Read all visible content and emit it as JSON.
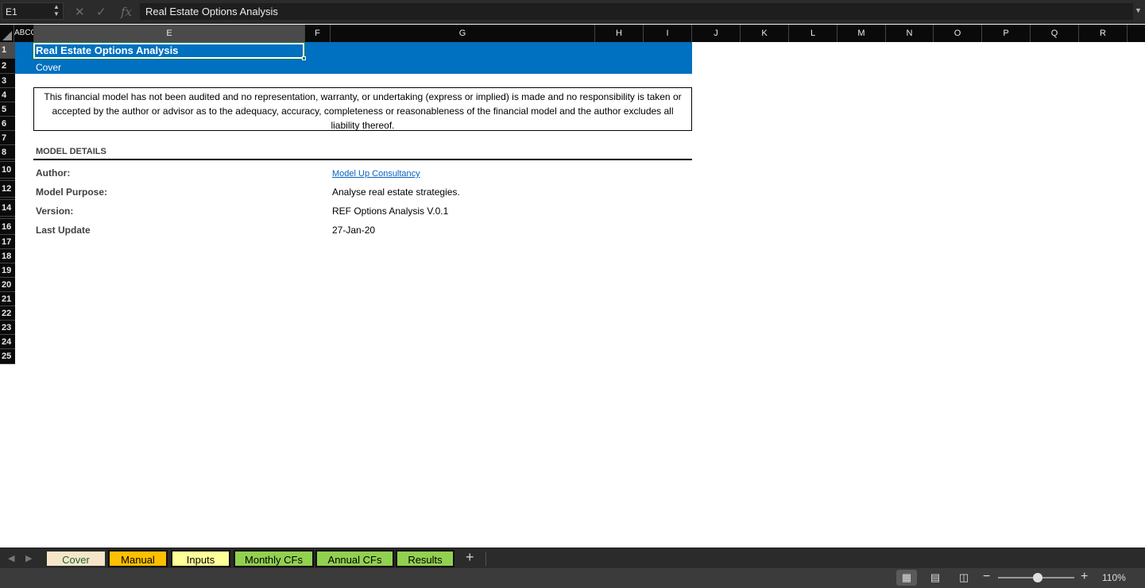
{
  "formula_bar": {
    "name_box": "E1",
    "formula": "Real Estate Options Analysis",
    "fx_label": "fx"
  },
  "columns": [
    "A",
    "B",
    "C",
    "C",
    "E",
    "F",
    "G",
    "H",
    "I",
    "J",
    "K",
    "L",
    "M",
    "N",
    "O",
    "P",
    "Q",
    "R"
  ],
  "columns_display": {
    "abcc": "ABCC",
    "e": "E",
    "f": "F",
    "g": "G",
    "h": "H",
    "i": "I",
    "j": "J",
    "k": "K",
    "l": "L",
    "m": "M",
    "n": "N",
    "o": "O",
    "p": "P",
    "q": "Q",
    "r": "R"
  },
  "rows": {
    "r1": "1",
    "r2": "2",
    "r3": "3",
    "r4": "4",
    "r5": "5",
    "r6": "6",
    "r7": "7",
    "r8": "8",
    "r10": "10",
    "r12": "12",
    "r14": "14",
    "r16": "16",
    "r17": "17",
    "r18": "18",
    "r19": "19",
    "r20": "20",
    "r21": "21",
    "r22": "22",
    "r23": "23",
    "r24": "24",
    "r25": "25"
  },
  "sheet": {
    "title": "Real Estate Options Analysis",
    "subtitle": "Cover",
    "disclaimer": "This financial model has not been audited and no representation, warranty, or undertaking (express or implied) is made and no responsibility is taken or accepted by the author or advisor as to the adequacy, accuracy, completeness or reasonableness of the financial model and the author excludes all liability thereof.",
    "section_heading": "MODEL DETAILS",
    "details": {
      "author_label": "Author:",
      "author_value": "Model Up Consultancy",
      "purpose_label": "Model Purpose:",
      "purpose_value": "Analyse real estate strategies.",
      "version_label": "Version:",
      "version_value": "REF Options Analysis V.0.1",
      "update_label": "Last Update",
      "update_value": "27-Jan-20"
    },
    "banner_color": "#0070c0"
  },
  "tabs": [
    {
      "label": "Cover",
      "color": "#f5e6c8"
    },
    {
      "label": "Manual",
      "color": "#ffc000"
    },
    {
      "label": "Inputs",
      "color": "#ffff99"
    },
    {
      "label": "Monthly CFs",
      "color": "#92d050"
    },
    {
      "label": "Annual CFs",
      "color": "#92d050"
    },
    {
      "label": "Results",
      "color": "#92d050"
    }
  ],
  "status_bar": {
    "zoom": "110%"
  }
}
